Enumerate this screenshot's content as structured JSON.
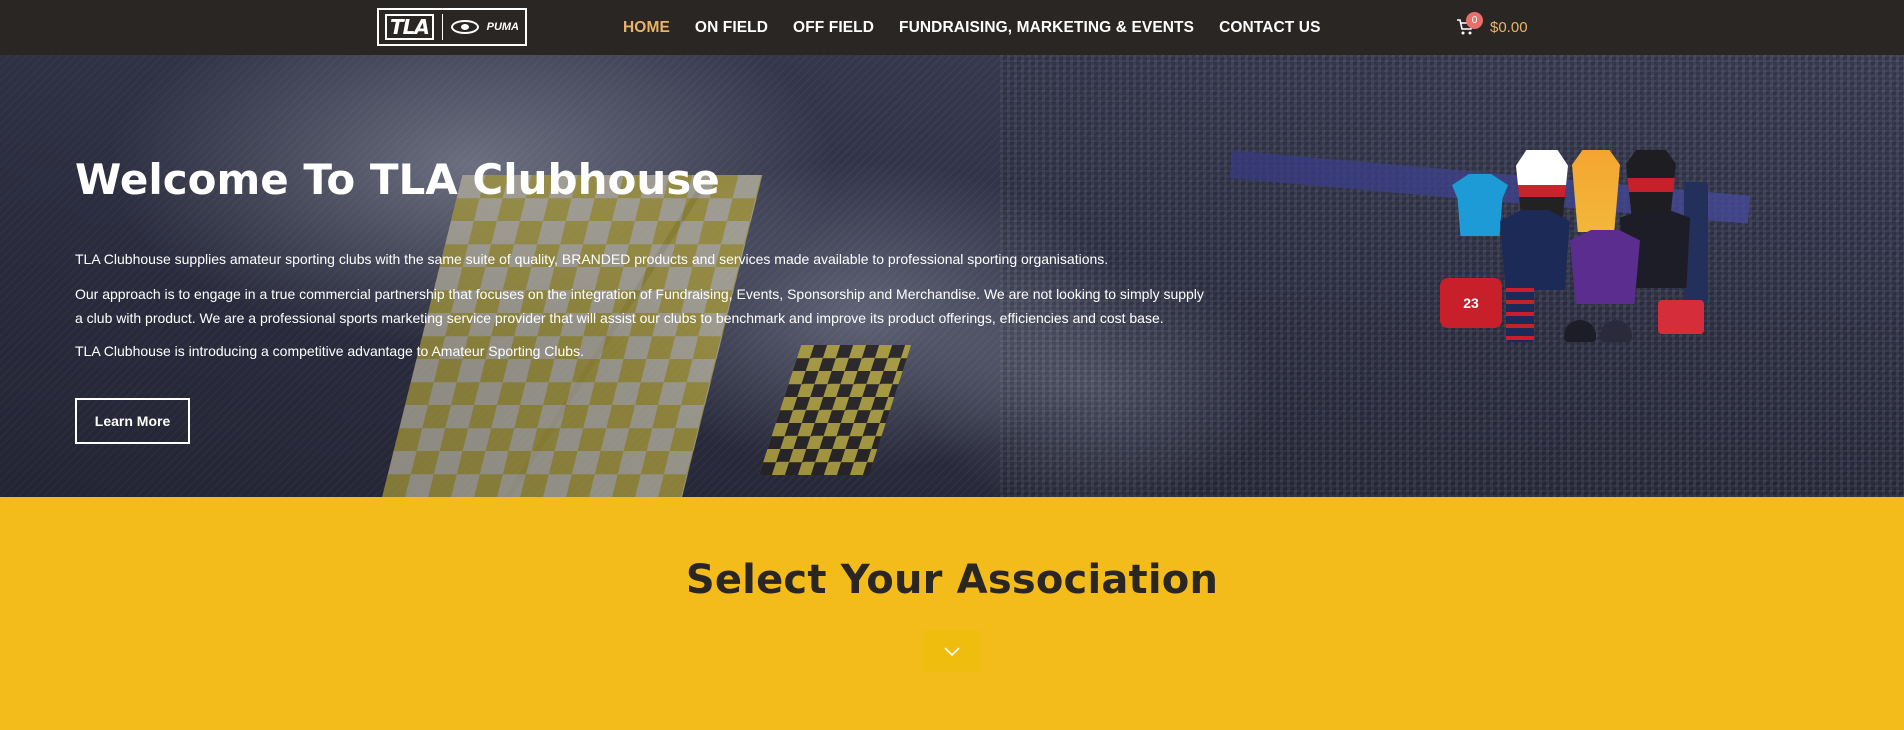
{
  "header": {
    "logo_text": "TLA",
    "logo_brand": "PUMA",
    "nav": [
      {
        "label": "HOME",
        "active": true
      },
      {
        "label": "ON FIELD",
        "active": false
      },
      {
        "label": "OFF FIELD",
        "active": false
      },
      {
        "label": "FUNDRAISING, MARKETING & EVENTS",
        "active": false
      },
      {
        "label": "CONTACT US",
        "active": false
      }
    ],
    "cart": {
      "count": "0",
      "total": "$0.00",
      "icon": "cart-icon"
    }
  },
  "hero": {
    "title": "Welcome To TLA Clubhouse",
    "paragraphs": [
      "TLA Clubhouse supplies amateur sporting clubs with the same suite of quality, BRANDED products and services made available to professional sporting organisations.",
      "Our approach is to engage in a true commercial partnership that focuses on the integration of Fundraising, Events, Sponsorship and Merchandise. We are not looking to simply supply a club with product. We are a professional sports marketing service provider that will assist our clubs to benchmark and improve its product offerings, efficiencies and cost base.",
      "TLA Clubhouse is introducing a competitive advantage to Amateur Sporting Clubs."
    ],
    "button_label": "Learn More",
    "merch_bag_number": "23"
  },
  "association": {
    "title": "Select Your Association",
    "toggle_icon": "chevron-down-icon"
  },
  "colors": {
    "header_bg": "#2a2623",
    "nav_active": "#e9b46a",
    "accent_yellow": "#f3bc1b",
    "cart_badge": "#e9706a"
  }
}
